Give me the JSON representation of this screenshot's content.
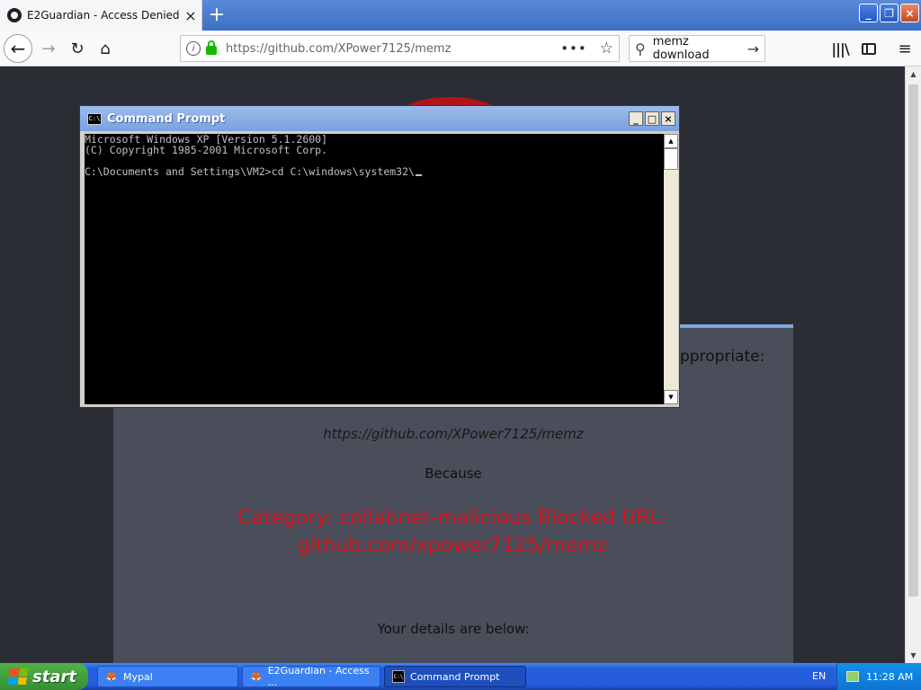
{
  "browser": {
    "tab_title": "E2Guardian - Access Denied",
    "tab_close": "×",
    "new_tab": "+",
    "url": "https://github.com/XPower7125/memz",
    "page_actions": "•••",
    "bookmark_star": "☆",
    "search_query": "memz download",
    "icons": {
      "back": "arrow-left-icon",
      "forward": "arrow-right-icon",
      "reload": "reload-icon",
      "home": "home-icon",
      "library": "library-icon",
      "sidebar": "sidebar-icon",
      "menu": "hamburger-menu-icon"
    },
    "window_caps": {
      "minimize": "_",
      "restore": "❐",
      "close": "×"
    }
  },
  "page": {
    "appropriate_text": "ppropriate:",
    "blocked_url": "https://github.com/XPower7125/memz",
    "because": "Because",
    "category": "Category: collabnet-malicious  Blocked URL: github.com/xpower7125/memz",
    "details": "Your details are below:",
    "colors": {
      "background": "#2b2d34",
      "panel": "#4a4d5a",
      "category": "#d8141c"
    }
  },
  "cmd": {
    "title": "Command Prompt",
    "icon_label": "C:\\",
    "caps": {
      "minimize": "_",
      "maximize": "□",
      "close": "×"
    },
    "lines": [
      "Microsoft Windows XP [Version 5.1.2600]",
      "(C) Copyright 1985-2001 Microsoft Corp.",
      "",
      "C:\\Documents and Settings\\VM2>cd C:\\windows\\system32\\"
    ]
  },
  "taskbar": {
    "start_label": "start",
    "tasks": [
      {
        "label": "Mypal",
        "active": false
      },
      {
        "label": "E2Guardian - Access ...",
        "active": false
      },
      {
        "label": "Command Prompt",
        "active": true
      }
    ],
    "language": "EN",
    "clock": "11:28 AM"
  }
}
